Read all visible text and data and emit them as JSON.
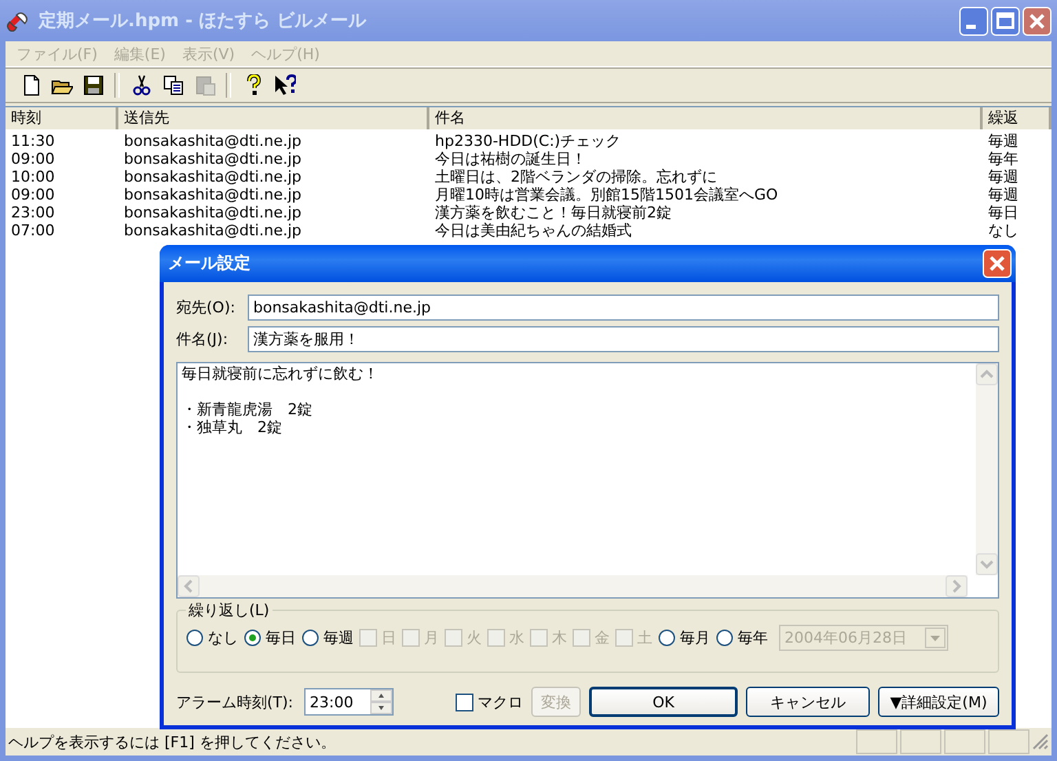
{
  "window": {
    "title": "定期メール.hpm - ほたすら ビルメール",
    "active": false
  },
  "menu": [
    {
      "label": "ファイル(F)",
      "disabled": true
    },
    {
      "label": "編集(E)",
      "disabled": true
    },
    {
      "label": "表示(V)",
      "disabled": true
    },
    {
      "label": "ヘルプ(H)",
      "disabled": true
    }
  ],
  "toolbar": [
    {
      "kind": "new",
      "disabled": false
    },
    {
      "kind": "open",
      "disabled": false
    },
    {
      "kind": "save",
      "disabled": false
    },
    {
      "kind": "separator"
    },
    {
      "kind": "cut",
      "disabled": false
    },
    {
      "kind": "copy",
      "disabled": false
    },
    {
      "kind": "paste",
      "disabled": true
    },
    {
      "kind": "separator"
    },
    {
      "kind": "help",
      "disabled": false
    },
    {
      "kind": "context-help",
      "disabled": false
    }
  ],
  "list": {
    "columns": [
      "時刻",
      "送信先",
      "件名",
      "繰返"
    ],
    "rows": [
      [
        "11:30",
        "bonsakashita@dti.ne.jp",
        "hp2330-HDD(C:)チェック",
        "毎週"
      ],
      [
        "09:00",
        "bonsakashita@dti.ne.jp",
        "今日は祐樹の誕生日！",
        "毎年"
      ],
      [
        "10:00",
        "bonsakashita@dti.ne.jp",
        "土曜日は、2階ベランダの掃除。忘れずに",
        "毎週"
      ],
      [
        "09:00",
        "bonsakashita@dti.ne.jp",
        "月曜10時は営業会議。別館15階1501会議室へGO",
        "毎週"
      ],
      [
        "23:00",
        "bonsakashita@dti.ne.jp",
        "漢方薬を飲むこと！毎日就寝前2錠",
        "毎日"
      ],
      [
        "07:00",
        "bonsakashita@dti.ne.jp",
        "今日は美由紀ちゃんの結婚式",
        "なし"
      ]
    ]
  },
  "dialog": {
    "title": "メール設定",
    "fields": [
      {
        "label": "宛先(O):",
        "value": "bonsakashita@dti.ne.jp"
      },
      {
        "label": "件名(J):",
        "value": "漢方薬を服用！"
      }
    ],
    "body": [
      [
        "毎日就寝前に忘れずに飲む！"
      ],
      [
        "・新青龍虎湯　2錠",
        "・独草丸　2錠"
      ]
    ],
    "repeat": {
      "label": "繰り返し(L)",
      "options": [
        {
          "kind": "radio",
          "label": "なし",
          "selected": false,
          "disabled": false
        },
        {
          "kind": "radio",
          "label": "毎日",
          "selected": true,
          "disabled": false
        },
        {
          "kind": "radio",
          "label": "毎週",
          "selected": false,
          "disabled": false
        },
        {
          "kind": "check",
          "label": "日",
          "checked": false,
          "disabled": true
        },
        {
          "kind": "check",
          "label": "月",
          "checked": false,
          "disabled": true
        },
        {
          "kind": "check",
          "label": "火",
          "checked": false,
          "disabled": true
        },
        {
          "kind": "check",
          "label": "水",
          "checked": false,
          "disabled": true
        },
        {
          "kind": "check",
          "label": "木",
          "checked": false,
          "disabled": true
        },
        {
          "kind": "check",
          "label": "金",
          "checked": false,
          "disabled": true
        },
        {
          "kind": "check",
          "label": "土",
          "checked": false,
          "disabled": true
        },
        {
          "kind": "radio",
          "label": "毎月",
          "selected": false,
          "disabled": false
        },
        {
          "kind": "radio",
          "label": "毎年",
          "selected": false,
          "disabled": false
        }
      ],
      "date": {
        "value": "2004年06月28日",
        "disabled": true
      }
    },
    "alarm": {
      "label": "アラーム時刻(T):",
      "value": "23:00"
    },
    "macro": {
      "label": "マクロ",
      "checked": false
    },
    "buttons": [
      {
        "label": "変換",
        "disabled": true,
        "default": false
      },
      {
        "label": "OK",
        "disabled": false,
        "default": true
      },
      {
        "label": "キャンセル",
        "disabled": false,
        "default": false
      },
      {
        "label": "▼詳細設定(M)",
        "disabled": false,
        "default": false
      }
    ]
  },
  "status_bar": {
    "text": "ヘルプを表示するには [F1] を押してください。"
  }
}
